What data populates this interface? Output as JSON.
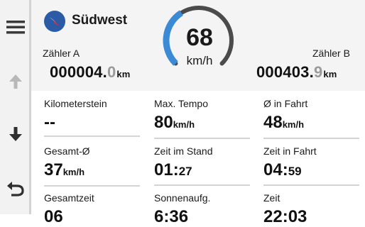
{
  "colors": {
    "accent_blue": "#3a8ad6",
    "gauge_track": "#4b4b4b",
    "compass_blue": "#2b5aa7",
    "compass_needle": "#d9332f"
  },
  "nav": {
    "menu_icon": "hamburger-menu-icon",
    "up_icon": "arrow-up-icon",
    "down_icon": "arrow-down-icon",
    "back_icon": "back-arrow-icon"
  },
  "header": {
    "heading": "Südwest",
    "trip_a": {
      "label": "Zähler A",
      "integer": "000004.",
      "decimal": "0",
      "unit": "km"
    },
    "trip_b": {
      "label": "Zähler B",
      "integer": "000403.",
      "decimal": "9",
      "unit": "km"
    },
    "speed": {
      "value": "68",
      "unit": "km/h",
      "gauge_fraction": 0.38
    }
  },
  "stats": [
    {
      "label": "Kilometerstein",
      "value": "--",
      "unit": ""
    },
    {
      "label": "Max. Tempo",
      "value": "80",
      "unit": "km/h"
    },
    {
      "label": "Ø in Fahrt",
      "value": "48",
      "unit": "km/h"
    },
    {
      "label": "Gesamt-Ø",
      "value": "37",
      "unit": "km/h"
    },
    {
      "label": "Zeit im Stand",
      "value": "01:",
      "seconds": "27"
    },
    {
      "label": "Zeit in Fahrt",
      "value": "04:",
      "seconds": "59"
    },
    {
      "label": "Gesamtzeit",
      "value": "06",
      "unit": ""
    },
    {
      "label": "Sonnenaufg.",
      "value": "6:36",
      "unit": ""
    },
    {
      "label": "Zeit",
      "value": "22:03",
      "unit": ""
    }
  ]
}
